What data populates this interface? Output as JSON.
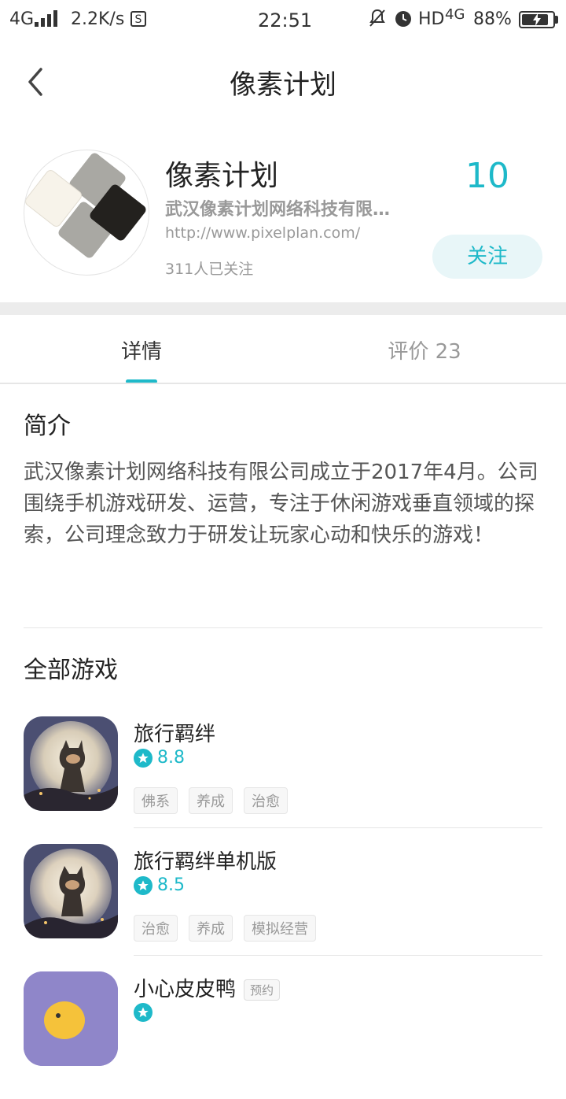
{
  "status_bar": {
    "network": "4G",
    "speed": "2.2K/s",
    "time": "22:51",
    "hd_label": "HD",
    "network2": "4G",
    "battery": "88%",
    "battery_level": 0.88
  },
  "nav": {
    "title": "像素计划",
    "back_icon": "chevron-left-icon"
  },
  "profile": {
    "name": "像素计划",
    "company": "武汉像素计划网络科技有限公司",
    "url": "http://www.pixelplan.com/",
    "followers": "311人已关注",
    "score": "10",
    "follow_label": "关注"
  },
  "tabs": [
    {
      "label": "详情",
      "active": true
    },
    {
      "label": "评价 23",
      "active": false
    }
  ],
  "intro": {
    "title": "简介",
    "text": "武汉像素计划网络科技有限公司成立于2017年4月。公司围绕手机游戏研发、运营，专注于休闲游戏垂直领域的探索，公司理念致力于研发让玩家心动和快乐的游戏！"
  },
  "games_section": {
    "title": "全部游戏",
    "games": [
      {
        "name": "旅行羁绊",
        "rating": "8.8",
        "tags": [
          "佛系",
          "养成",
          "治愈"
        ],
        "badge": ""
      },
      {
        "name": "旅行羁绊单机版",
        "rating": "8.5",
        "tags": [
          "治愈",
          "养成",
          "模拟经营"
        ],
        "badge": ""
      },
      {
        "name": "小心皮皮鸭",
        "rating": "",
        "tags": [],
        "badge": "预约"
      }
    ]
  },
  "colors": {
    "accent": "#1eb9c9",
    "follow_bg": "#e8f6f8"
  }
}
